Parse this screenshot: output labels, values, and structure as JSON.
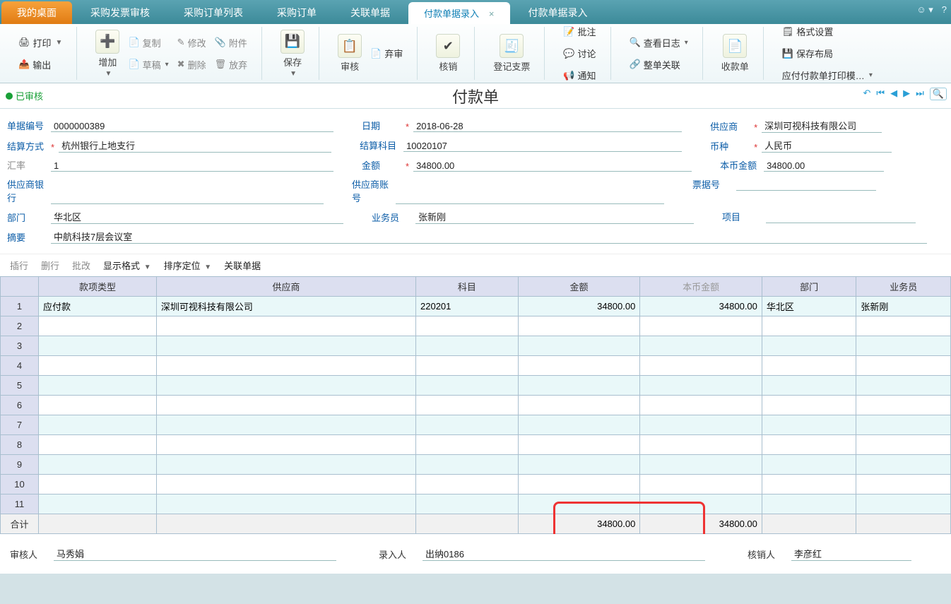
{
  "tabs": {
    "home": "我的桌面",
    "items": [
      "采购发票审核",
      "采购订单列表",
      "采购订单",
      "关联单据"
    ],
    "active": "付款单据录入",
    "after": [
      "付款单据录入"
    ]
  },
  "ribbon": {
    "print": "打印",
    "export": "输出",
    "add": "增加",
    "copy": "复制",
    "edit": "修改",
    "attach": "附件",
    "draft": "草稿",
    "delete": "删除",
    "discard": "放弃",
    "save": "保存",
    "audit": "审核",
    "abandon": "弃审",
    "verify": "核销",
    "register": "登记支票",
    "note": "批注",
    "discuss": "讨论",
    "notify": "通知",
    "viewlog": "查看日志",
    "wholeassoc": "整单关联",
    "receipt": "收款单",
    "format": "格式设置",
    "savelayout": "保存布局",
    "printtmpl": "应付付款单打印模…"
  },
  "status": "已审核",
  "doctitle": "付款单",
  "form": {
    "doc_no_label": "单据编号",
    "doc_no": "0000000389",
    "date_label": "日期",
    "date": "2018-06-28",
    "supplier_label": "供应商",
    "supplier": "深圳可视科技有限公司",
    "settle_label": "结算方式",
    "settle": "杭州银行上地支行",
    "acct_label": "结算科目",
    "acct": "10020107",
    "currency_label": "币种",
    "currency": "人民币",
    "rate_label": "汇率",
    "rate": "1",
    "amount_label": "金额",
    "amount": "34800.00",
    "localamt_label": "本币金额",
    "localamt": "34800.00",
    "supbank_label": "供应商银行",
    "supbank": "",
    "supacct_label": "供应商账号",
    "supacct": "",
    "billno_label": "票据号",
    "billno": "",
    "dept_label": "部门",
    "dept": "华北区",
    "sales_label": "业务员",
    "sales": "张新刚",
    "project_label": "项目",
    "project": "",
    "summary_label": "摘要",
    "summary": "中航科技7层会议室"
  },
  "actions": {
    "insert": "插行",
    "delrow": "删行",
    "batch": "批改",
    "dispfmt": "显示格式",
    "sort": "排序定位",
    "assoc": "关联单据"
  },
  "table": {
    "headers": [
      "款项类型",
      "供应商",
      "科目",
      "金额",
      "本币金额",
      "部门",
      "业务员"
    ],
    "rows": [
      {
        "n": "1",
        "type": "应付款",
        "supplier": "深圳可视科技有限公司",
        "acct": "220201",
        "amt": "34800.00",
        "localamt": "34800.00",
        "dept": "华北区",
        "sales": "张新刚"
      }
    ],
    "blank": [
      "2",
      "3",
      "4",
      "5",
      "6",
      "7",
      "8",
      "9",
      "10",
      "11"
    ],
    "total_label": "合计",
    "total_amt": "34800.00",
    "total_local": "34800.00"
  },
  "footer": {
    "auditor_label": "审核人",
    "auditor": "马秀娟",
    "entry_label": "录入人",
    "entry": "出纳0186",
    "verifier_label": "核销人",
    "verifier": "李彦红"
  }
}
